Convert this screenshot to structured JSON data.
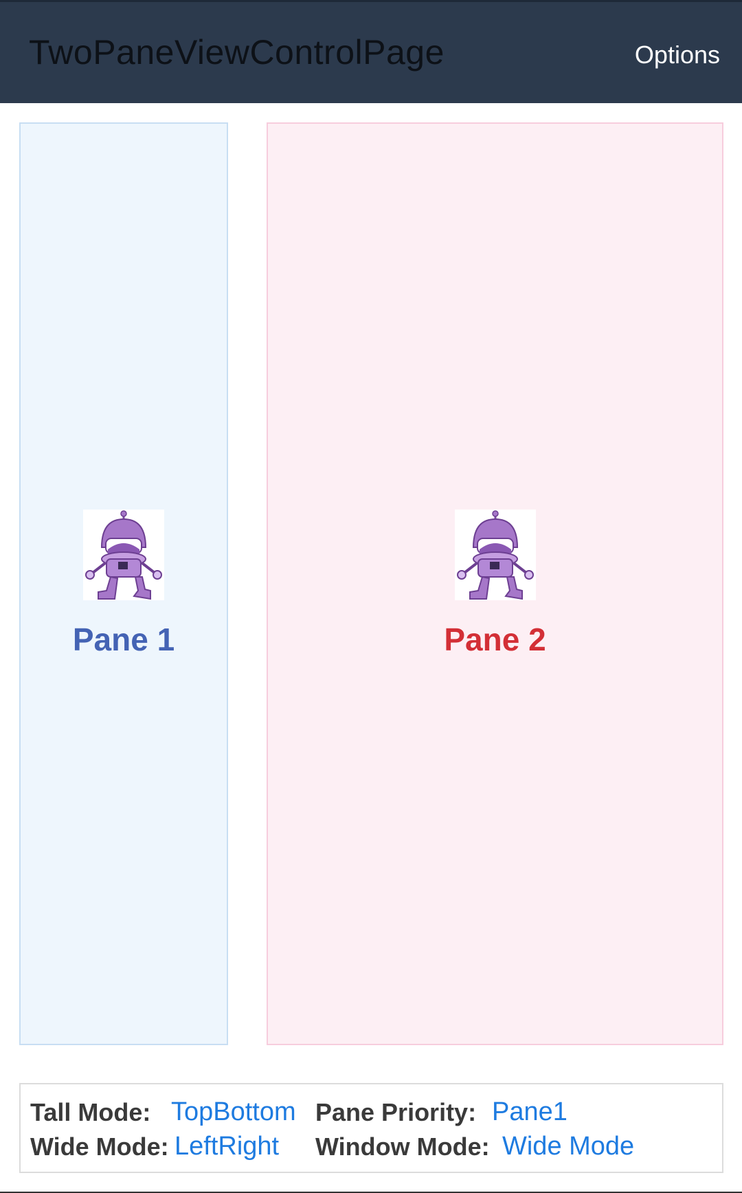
{
  "header": {
    "title": "TwoPaneViewControlPage",
    "options_label": "Options"
  },
  "pane1": {
    "label": "Pane 1",
    "color": "#4463b4"
  },
  "pane2": {
    "label": "Pane 2",
    "color": "#d32f36"
  },
  "status": {
    "tall_mode_label": "Tall Mode:",
    "tall_mode_value": "TopBottom",
    "wide_mode_label": "Wide Mode:",
    "wide_mode_value": "LeftRight",
    "pane_priority_label": "Pane Priority:",
    "pane_priority_value": "Pane1",
    "window_mode_label": "Window Mode:",
    "window_mode_value": "Wide Mode"
  },
  "icons": {
    "robot": "dotnet-bot-icon"
  }
}
